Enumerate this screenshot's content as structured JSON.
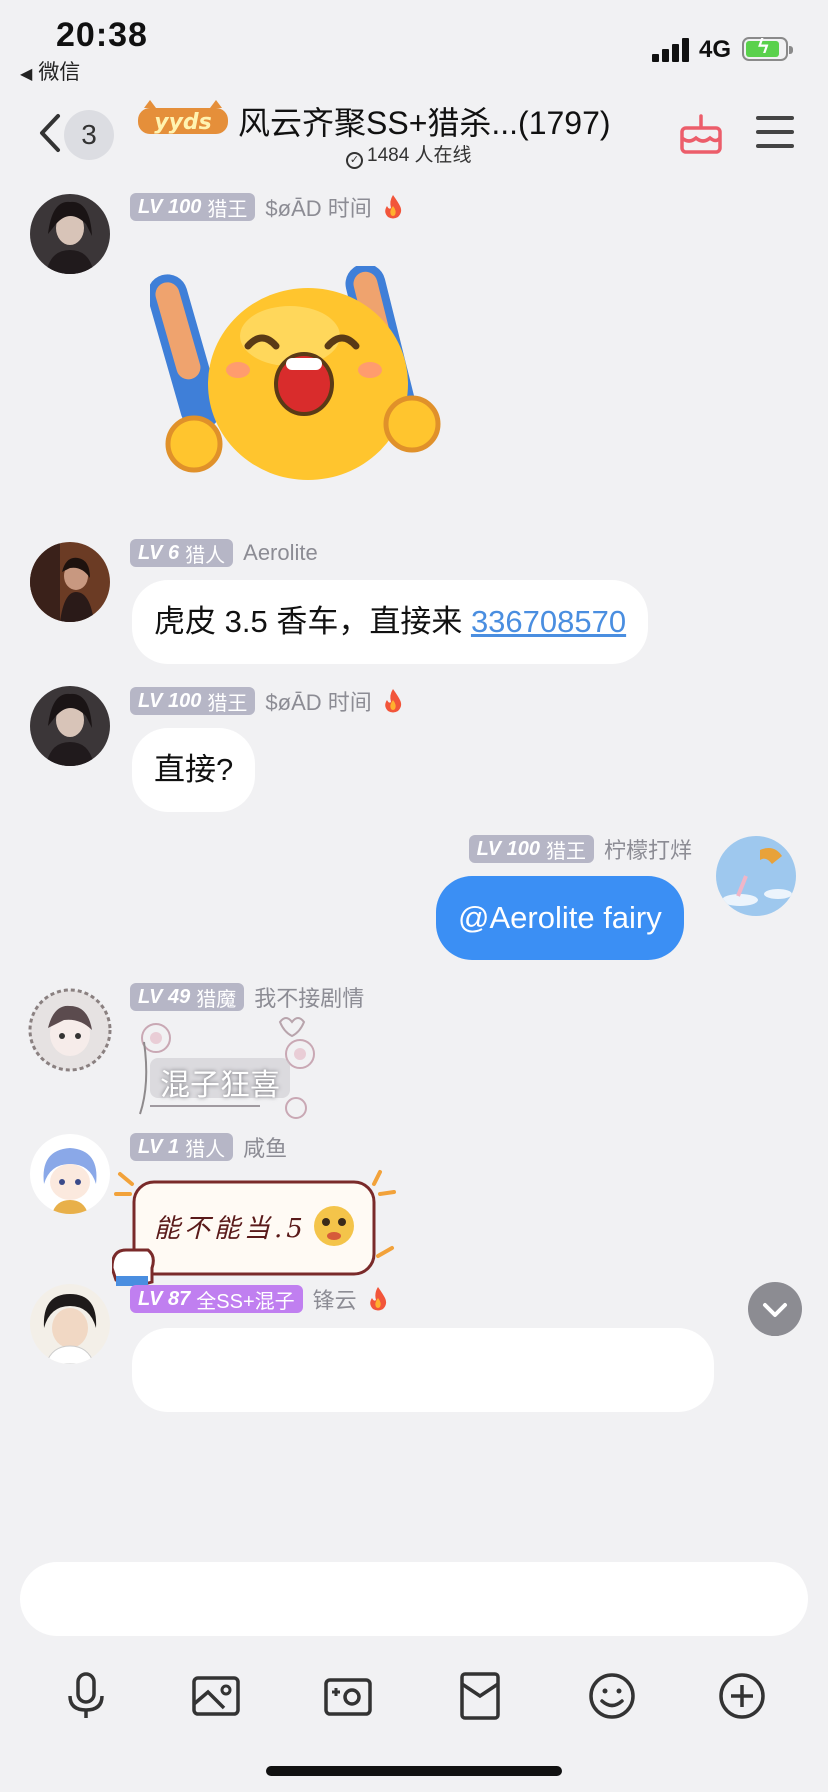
{
  "status_bar": {
    "time": "20:38",
    "back_app": "微信",
    "network": "4G"
  },
  "nav": {
    "unread_count": "3",
    "logo_text": "yyds",
    "title": "风云齐聚SS+猎杀...(1797)",
    "online": "1484 人在线"
  },
  "messages": [
    {
      "level": "LV 100",
      "rank": "猎王",
      "name": "$øĀD 时间",
      "fire": true,
      "content_type": "sticker",
      "sticker": "cheering-emoji"
    },
    {
      "level": "LV 6",
      "rank": "猎人",
      "name": "Aerolite",
      "fire": false,
      "content_type": "text",
      "text": "虎皮 3.5 香车，直接来 ",
      "link": "336708570"
    },
    {
      "level": "LV 100",
      "rank": "猎王",
      "name": "$øĀD 时间",
      "fire": true,
      "content_type": "text",
      "text": "直接?"
    },
    {
      "level": "LV 100",
      "rank": "猎王",
      "name": "柠檬打烊",
      "fire": false,
      "content_type": "text",
      "text": "@Aerolite fairy",
      "outgoing": true
    },
    {
      "level": "LV 49",
      "rank": "猎魔",
      "name": "我不接剧情",
      "fire": false,
      "content_type": "sticker",
      "sticker_text": "混子狂喜"
    },
    {
      "level": "LV 1",
      "rank": "猎人",
      "name": "咸鱼",
      "fire": false,
      "content_type": "sticker",
      "sticker_text": "能不能当.5"
    },
    {
      "level": "LV 87",
      "rank": "全SS+混子",
      "name": "锋云",
      "fire": true,
      "content_type": "text",
      "text": ""
    }
  ],
  "colors": {
    "accent_blue": "#3b8ff4",
    "level_badge": "#b6b6c6",
    "level_badge_purple": "#c07ff0",
    "link": "#4a8ee0"
  },
  "toolbar_icons": [
    "microphone-icon",
    "image-icon",
    "camera-icon",
    "red-packet-icon",
    "emoji-icon",
    "plus-icon"
  ]
}
